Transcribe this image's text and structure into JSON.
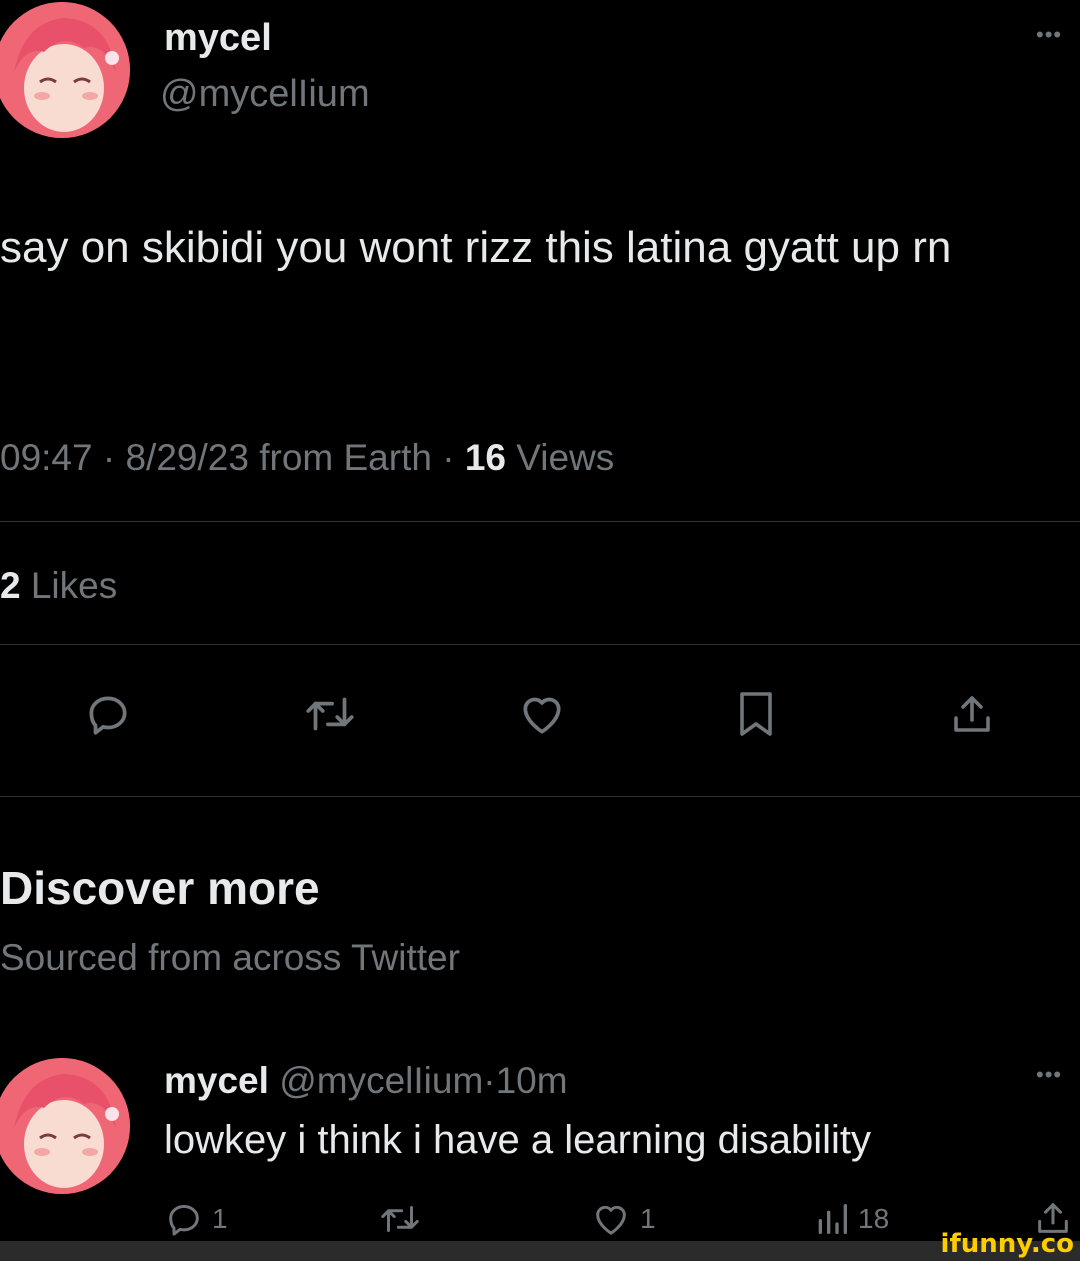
{
  "tweet": {
    "display_name": "mycel",
    "handle": "@mycelIium",
    "more_label": "•••",
    "text": "say on skibidi you wont rizz this latina gyatt up rn",
    "time": "09:47",
    "date": "8/29/23",
    "source": "from Earth",
    "sep": "·",
    "views_count": "16",
    "views_label": "Views",
    "likes_count": "2",
    "likes_label": "Likes"
  },
  "actions": {
    "icons": [
      "reply-icon",
      "retweet-icon",
      "like-icon",
      "bookmark-icon",
      "share-icon"
    ]
  },
  "discover": {
    "title": "Discover more",
    "subtitle": "Sourced from across Twitter"
  },
  "reply": {
    "display_name": "mycel",
    "handle": "@mycelIium",
    "sep": "·",
    "time": "10m",
    "more_label": "•••",
    "text": "lowkey i think i have a learning disability",
    "reply_count": "1",
    "like_count": "1",
    "views_count": "18"
  },
  "watermark": {
    "text": "ifunny.co"
  },
  "colors": {
    "background": "#000000",
    "text_primary": "#e7e9ea",
    "text_muted": "#71767b",
    "divider": "#2f3336",
    "watermark": "#ffcc00"
  }
}
